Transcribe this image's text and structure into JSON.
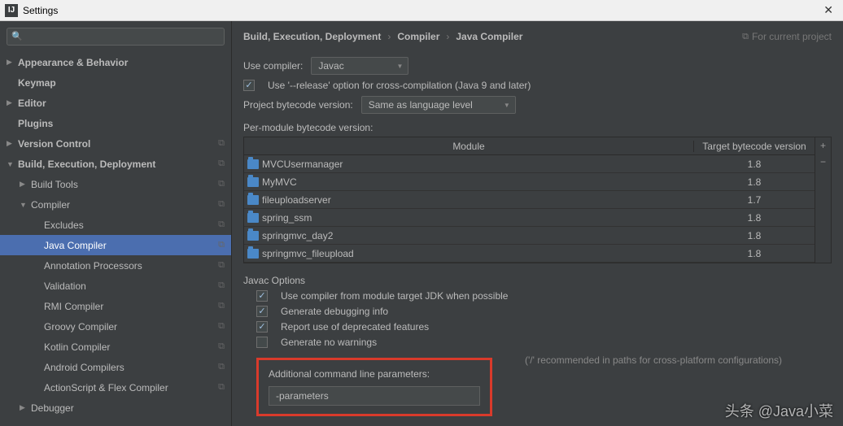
{
  "titlebar": {
    "title": "Settings"
  },
  "search": {
    "placeholder": ""
  },
  "sidebar": {
    "items": [
      {
        "label": "Appearance & Behavior",
        "arrow": "▶",
        "bold": true,
        "ind": 0
      },
      {
        "label": "Keymap",
        "arrow": "",
        "bold": true,
        "ind": 0
      },
      {
        "label": "Editor",
        "arrow": "▶",
        "bold": true,
        "ind": 0
      },
      {
        "label": "Plugins",
        "arrow": "",
        "bold": true,
        "ind": 0
      },
      {
        "label": "Version Control",
        "arrow": "▶",
        "bold": true,
        "ind": 0,
        "copy": true
      },
      {
        "label": "Build, Execution, Deployment",
        "arrow": "▼",
        "bold": true,
        "ind": 0,
        "copy": true
      },
      {
        "label": "Build Tools",
        "arrow": "▶",
        "ind": 1,
        "copy": true
      },
      {
        "label": "Compiler",
        "arrow": "▼",
        "ind": 1,
        "copy": true
      },
      {
        "label": "Excludes",
        "arrow": "",
        "ind": 2,
        "copy": true
      },
      {
        "label": "Java Compiler",
        "arrow": "",
        "ind": 2,
        "copy": true,
        "selected": true
      },
      {
        "label": "Annotation Processors",
        "arrow": "",
        "ind": 2,
        "copy": true
      },
      {
        "label": "Validation",
        "arrow": "",
        "ind": 2,
        "copy": true
      },
      {
        "label": "RMI Compiler",
        "arrow": "",
        "ind": 2,
        "copy": true
      },
      {
        "label": "Groovy Compiler",
        "arrow": "",
        "ind": 2,
        "copy": true
      },
      {
        "label": "Kotlin Compiler",
        "arrow": "",
        "ind": 2,
        "copy": true
      },
      {
        "label": "Android Compilers",
        "arrow": "",
        "ind": 2,
        "copy": true
      },
      {
        "label": "ActionScript & Flex Compiler",
        "arrow": "",
        "ind": 2,
        "copy": true
      },
      {
        "label": "Debugger",
        "arrow": "▶",
        "ind": 1
      }
    ]
  },
  "breadcrumbs": [
    "Build, Execution, Deployment",
    "Compiler",
    "Java Compiler"
  ],
  "for_project": "For current project",
  "use_compiler": {
    "label": "Use compiler:",
    "value": "Javac"
  },
  "release_opt": {
    "label": "Use '--release' option for cross-compilation (Java 9 and later)",
    "checked": true
  },
  "bytecode": {
    "label": "Project bytecode version:",
    "value": "Same as language level"
  },
  "per_module_label": "Per-module bytecode version:",
  "table": {
    "headers": {
      "module": "Module",
      "version": "Target bytecode version"
    },
    "rows": [
      {
        "name": "MVCUsermanager",
        "ver": "1.8"
      },
      {
        "name": "MyMVC",
        "ver": "1.8"
      },
      {
        "name": "fileuploadserver",
        "ver": "1.7"
      },
      {
        "name": "spring_ssm",
        "ver": "1.8"
      },
      {
        "name": "springmvc_day2",
        "ver": "1.8"
      },
      {
        "name": "springmvc_fileupload",
        "ver": "1.8"
      }
    ]
  },
  "javac": {
    "title": "Javac Options",
    "opts": [
      {
        "label": "Use compiler from module target JDK when possible",
        "checked": true
      },
      {
        "label": "Generate debugging info",
        "checked": true
      },
      {
        "label": "Report use of deprecated features",
        "checked": true
      },
      {
        "label": "Generate no warnings",
        "checked": false
      }
    ],
    "cmdline_label": "Additional command line parameters:",
    "cmdline_value": "-parameters",
    "hint": "('/' recommended in paths for cross-platform configurations)"
  },
  "watermark": "头条 @Java小菜"
}
